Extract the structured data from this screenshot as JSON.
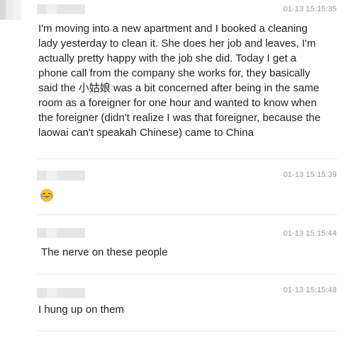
{
  "comments": [
    {
      "time": "01-13 15:15:35",
      "text": "I'm moving into a new apartment and I booked a cleaning lady yesterday to clean it. She does her job and leaves, I'm actually pretty happy with the job she did. Today I get a phone call from the company she works for, they basically said the 小姑娘 was a bit concerned after being in the same room as a foreigner for one hour and wanted to know when the foreigner (didn't realize I was that foreigner, because the laowai can't speakah Chinese) came to China"
    },
    {
      "time": "01-13 15:15:39",
      "emoji": "laughing-crying-emoji"
    },
    {
      "time": "01-13 15:15:44",
      "text": "The nerve on these people"
    },
    {
      "time": "01-13 15:15:48",
      "text": "I hung up on them"
    }
  ]
}
